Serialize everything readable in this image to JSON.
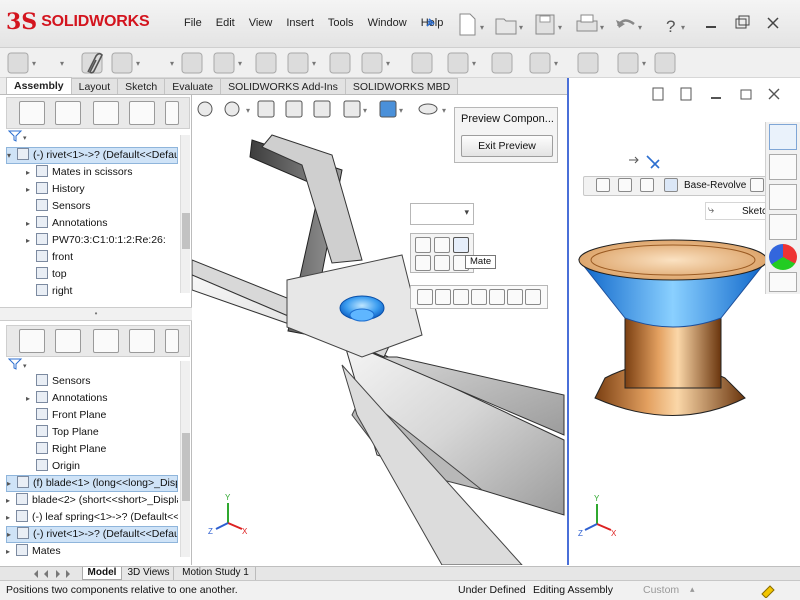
{
  "app": {
    "logo_text": "SOLIDWORKS",
    "logo_mark": "3S"
  },
  "menu": [
    "File",
    "Edit",
    "View",
    "Insert",
    "Tools",
    "Window",
    "Help"
  ],
  "command_tabs": [
    "Assembly",
    "Layout",
    "Sketch",
    "Evaluate",
    "SOLIDWORKS Add-Ins",
    "SOLIDWORKS MBD"
  ],
  "active_command_tab": "Assembly",
  "tree_top": [
    {
      "label": "(-) rivet<1>->? (Default<<Defaul",
      "level": 0,
      "selected": true,
      "arrow": "▾",
      "icon": "component-icon"
    },
    {
      "label": "Mates in scissors",
      "level": 1,
      "arrow": "▸",
      "icon": "mates-icon"
    },
    {
      "label": "History",
      "level": 1,
      "arrow": "▸",
      "icon": "history-icon"
    },
    {
      "label": "Sensors",
      "level": 1,
      "arrow": "",
      "icon": "sensors-icon"
    },
    {
      "label": "Annotations",
      "level": 1,
      "arrow": "▸",
      "icon": "annotations-icon"
    },
    {
      "label": "PW70:3:C1:0:1:2:Re:26:",
      "level": 1,
      "arrow": "▸",
      "icon": "material-icon"
    },
    {
      "label": "front",
      "level": 1,
      "arrow": "",
      "icon": "plane-icon"
    },
    {
      "label": "top",
      "level": 1,
      "arrow": "",
      "icon": "plane-icon"
    },
    {
      "label": "right",
      "level": 1,
      "arrow": "",
      "icon": "plane-icon"
    }
  ],
  "tree_bottom": [
    {
      "label": "Sensors",
      "level": 1,
      "arrow": "",
      "icon": "sensors-icon"
    },
    {
      "label": "Annotations",
      "level": 1,
      "arrow": "▸",
      "icon": "annotations-icon"
    },
    {
      "label": "Front Plane",
      "level": 1,
      "arrow": "",
      "icon": "plane-icon"
    },
    {
      "label": "Top Plane",
      "level": 1,
      "arrow": "",
      "icon": "plane-icon"
    },
    {
      "label": "Right Plane",
      "level": 1,
      "arrow": "",
      "icon": "plane-icon"
    },
    {
      "label": "Origin",
      "level": 1,
      "arrow": "",
      "icon": "origin-icon"
    },
    {
      "label": "(f) blade<1> (long<<long>_Disp",
      "level": 0,
      "selected": true,
      "arrow": "▸",
      "icon": "component-icon"
    },
    {
      "label": "blade<2> (short<<short>_Displa",
      "level": 0,
      "arrow": "▸",
      "icon": "component-icon"
    },
    {
      "label": "(-) leaf spring<1>->? (Default<<",
      "level": 0,
      "arrow": "▸",
      "icon": "component-icon"
    },
    {
      "label": "(-) rivet<1>->? (Default<<Defaul",
      "level": 0,
      "selected": true,
      "arrow": "▸",
      "icon": "component-icon"
    },
    {
      "label": "Mates",
      "level": 0,
      "arrow": "▸",
      "icon": "mates-icon"
    }
  ],
  "preview_popup": {
    "title": "Preview Compon...",
    "exit_button": "Exit Preview"
  },
  "mate_tooltip": "Mate",
  "preview_breadcrumb": {
    "feature": "Base-Revolve",
    "sketch": "Sketch"
  },
  "bottom_tabs": [
    "Model",
    "3D Views",
    "Motion Study 1"
  ],
  "active_bottom_tab": "Model",
  "status": {
    "message": "Positions two components relative to one another.",
    "state": "Under Defined",
    "mode": "Editing Assembly",
    "units": "Custom"
  },
  "triad_labels": {
    "x": "X",
    "y": "Y",
    "z": "Z"
  },
  "colors": {
    "brand": "#d3141e",
    "selection": "#cfe3f7",
    "preview_border": "#4a6fd8",
    "rivet_copper": "#c8782e",
    "rivet_highlight": "#2a8fe6"
  }
}
